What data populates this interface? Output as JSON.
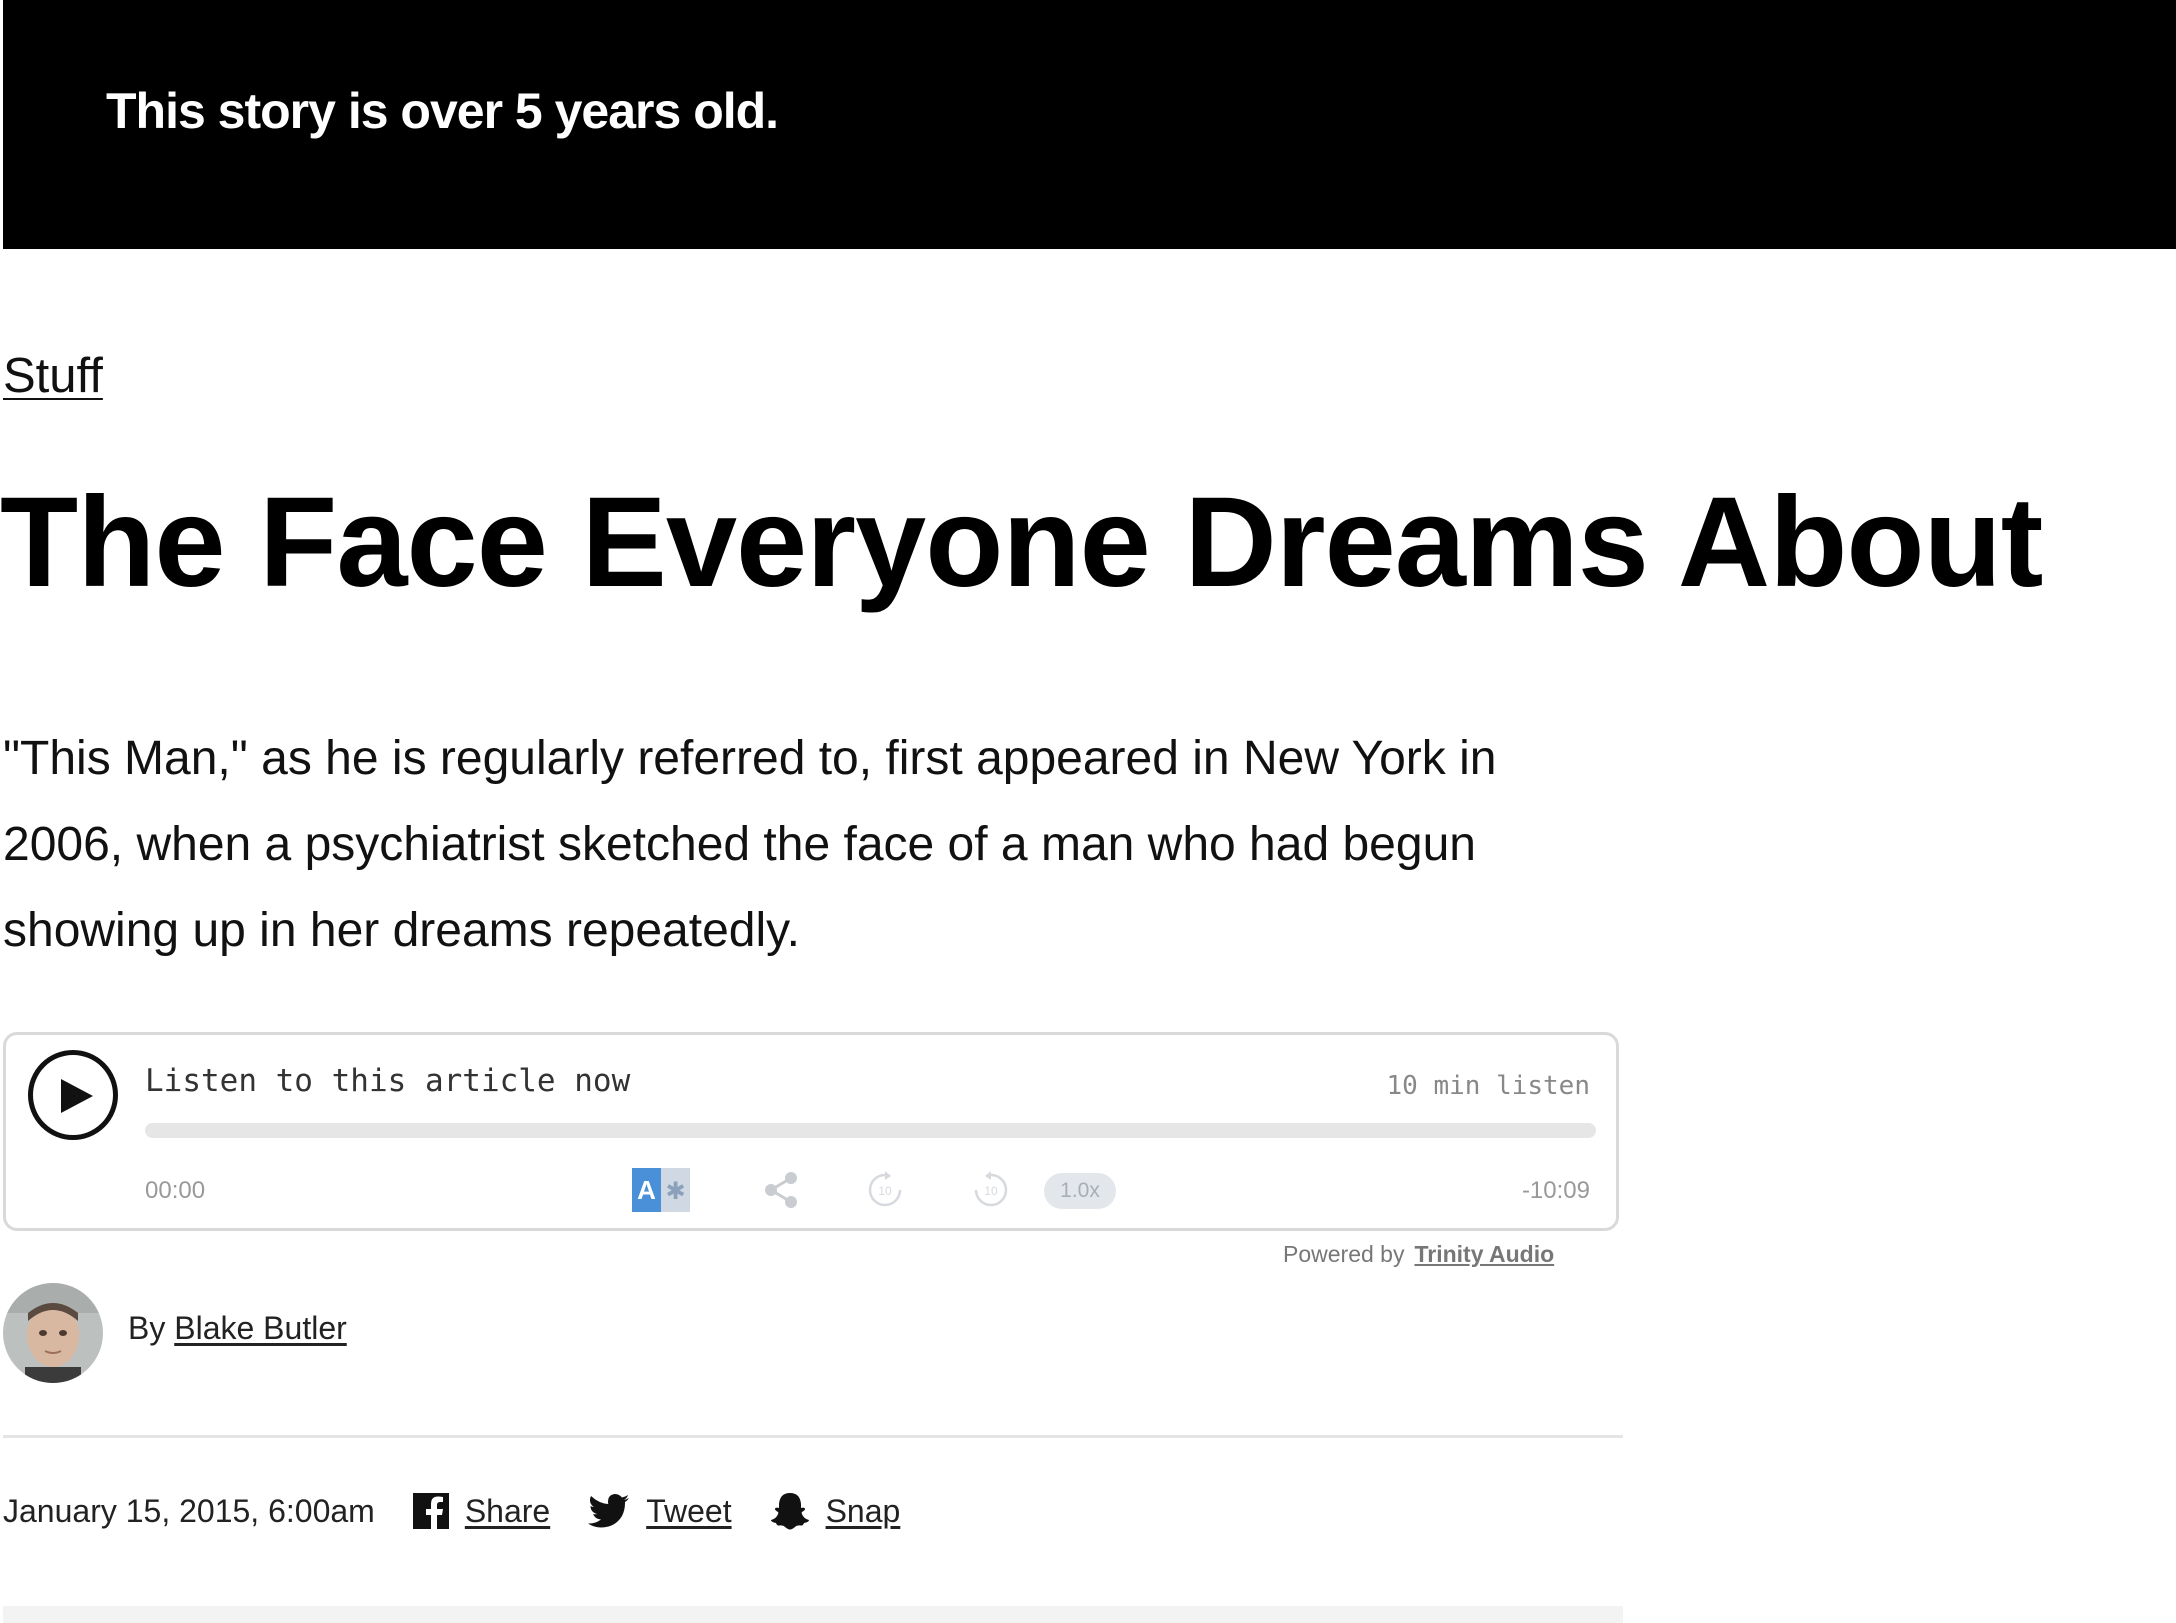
{
  "banner": {
    "text": "This story is over 5 years old."
  },
  "article": {
    "section": "Stuff",
    "headline": "The Face Everyone Dreams About",
    "dek": "\"This Man,\" as he is regularly referred to, first appeared in New York in 2006, when a psychiatrist sketched the face of a man who had begun showing up in her dreams repeatedly."
  },
  "player": {
    "label": "Listen to this article now",
    "length": "10 min listen",
    "time_current": "00:00",
    "time_remaining": "-10:09",
    "progress": 0,
    "speed": "1.0x",
    "powered_by_prefix": "Powered by",
    "powered_by_brand": "Trinity Audio",
    "icons": [
      "play-icon",
      "translate-icon",
      "share-icon",
      "rewind-10-icon",
      "forward-10-icon"
    ]
  },
  "author": {
    "prefix": "By",
    "name": "Blake Butler"
  },
  "meta": {
    "date": "January 15, 2015, 6:00am",
    "share_label": "Share",
    "tweet_label": "Tweet",
    "snap_label": "Snap"
  },
  "colors": {
    "banner_bg": "#000000",
    "banner_text": "#ffffff",
    "player_border": "#d9d9d9",
    "translate_blue": "#4a90d9"
  }
}
